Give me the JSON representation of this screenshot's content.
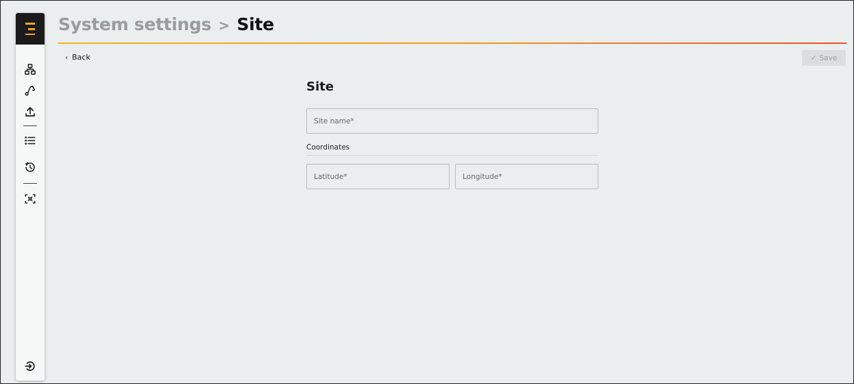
{
  "header": {
    "breadcrumb_parent": "System settings",
    "breadcrumb_separator": ">",
    "breadcrumb_current": "Site"
  },
  "toolbar": {
    "back_label": "Back",
    "back_icon": "‹",
    "save_label": "Save",
    "save_icon": "✓"
  },
  "form": {
    "title": "Site",
    "site_name": {
      "placeholder": "Site name*",
      "value": ""
    },
    "coordinates_label": "Coordinates",
    "latitude": {
      "placeholder": "Latitude*",
      "value": ""
    },
    "longitude": {
      "placeholder": "Longitude*",
      "value": ""
    }
  },
  "sidebar": {
    "items": [
      {
        "icon": "hierarchy-icon"
      },
      {
        "icon": "route-icon"
      },
      {
        "icon": "upload-icon"
      },
      {
        "icon": "list-icon"
      },
      {
        "icon": "history-icon"
      },
      {
        "icon": "focus-scan-icon"
      },
      {
        "icon": "logout-icon"
      }
    ]
  },
  "colors": {
    "accent_start": "#f0b51e",
    "accent_end": "#e8502a",
    "logo_bg": "#1b1b1b",
    "logo_mark": "#f5a623",
    "background": "#eaeeee"
  }
}
